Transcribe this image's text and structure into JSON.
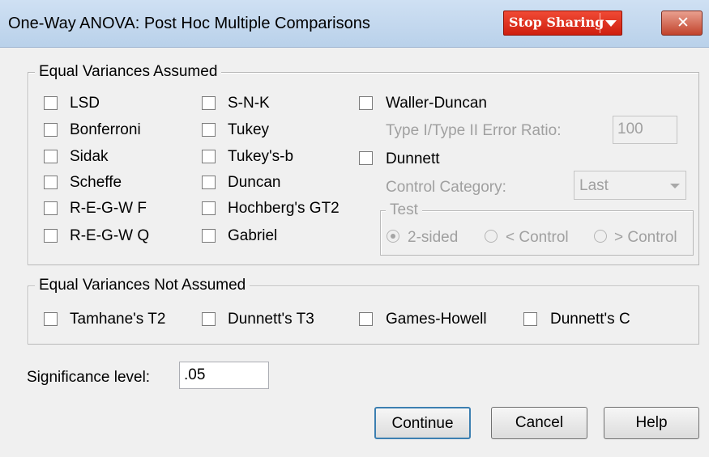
{
  "window": {
    "title": "One-Way ANOVA: Post Hoc Multiple Comparisons",
    "stop_sharing_label": "Stop Sharing",
    "close_label": "✕"
  },
  "equal_assumed": {
    "title": "Equal Variances Assumed",
    "col1": [
      "LSD",
      "Bonferroni",
      "Sidak",
      "Scheffe",
      "R-E-G-W F",
      "R-E-G-W Q"
    ],
    "col2": [
      "S-N-K",
      "Tukey",
      "Tukey's-b",
      "Duncan",
      "Hochberg's GT2",
      "Gabriel"
    ],
    "waller_duncan": "Waller-Duncan",
    "error_ratio_label": "Type I/Type II Error Ratio:",
    "error_ratio_value": "100",
    "dunnett": "Dunnett",
    "control_category_label": "Control Category:",
    "control_category_value": "Last",
    "test": {
      "title": "Test",
      "options": [
        "2-sided",
        "< Control",
        "> Control"
      ],
      "selected": "2-sided"
    }
  },
  "equal_not_assumed": {
    "title": "Equal Variances Not Assumed",
    "options": [
      "Tamhane's T2",
      "Dunnett's T3",
      "Games-Howell",
      "Dunnett's C"
    ]
  },
  "significance": {
    "label": "Significance level:",
    "value": ".05"
  },
  "buttons": {
    "continue": "Continue",
    "cancel": "Cancel",
    "help": "Help"
  }
}
